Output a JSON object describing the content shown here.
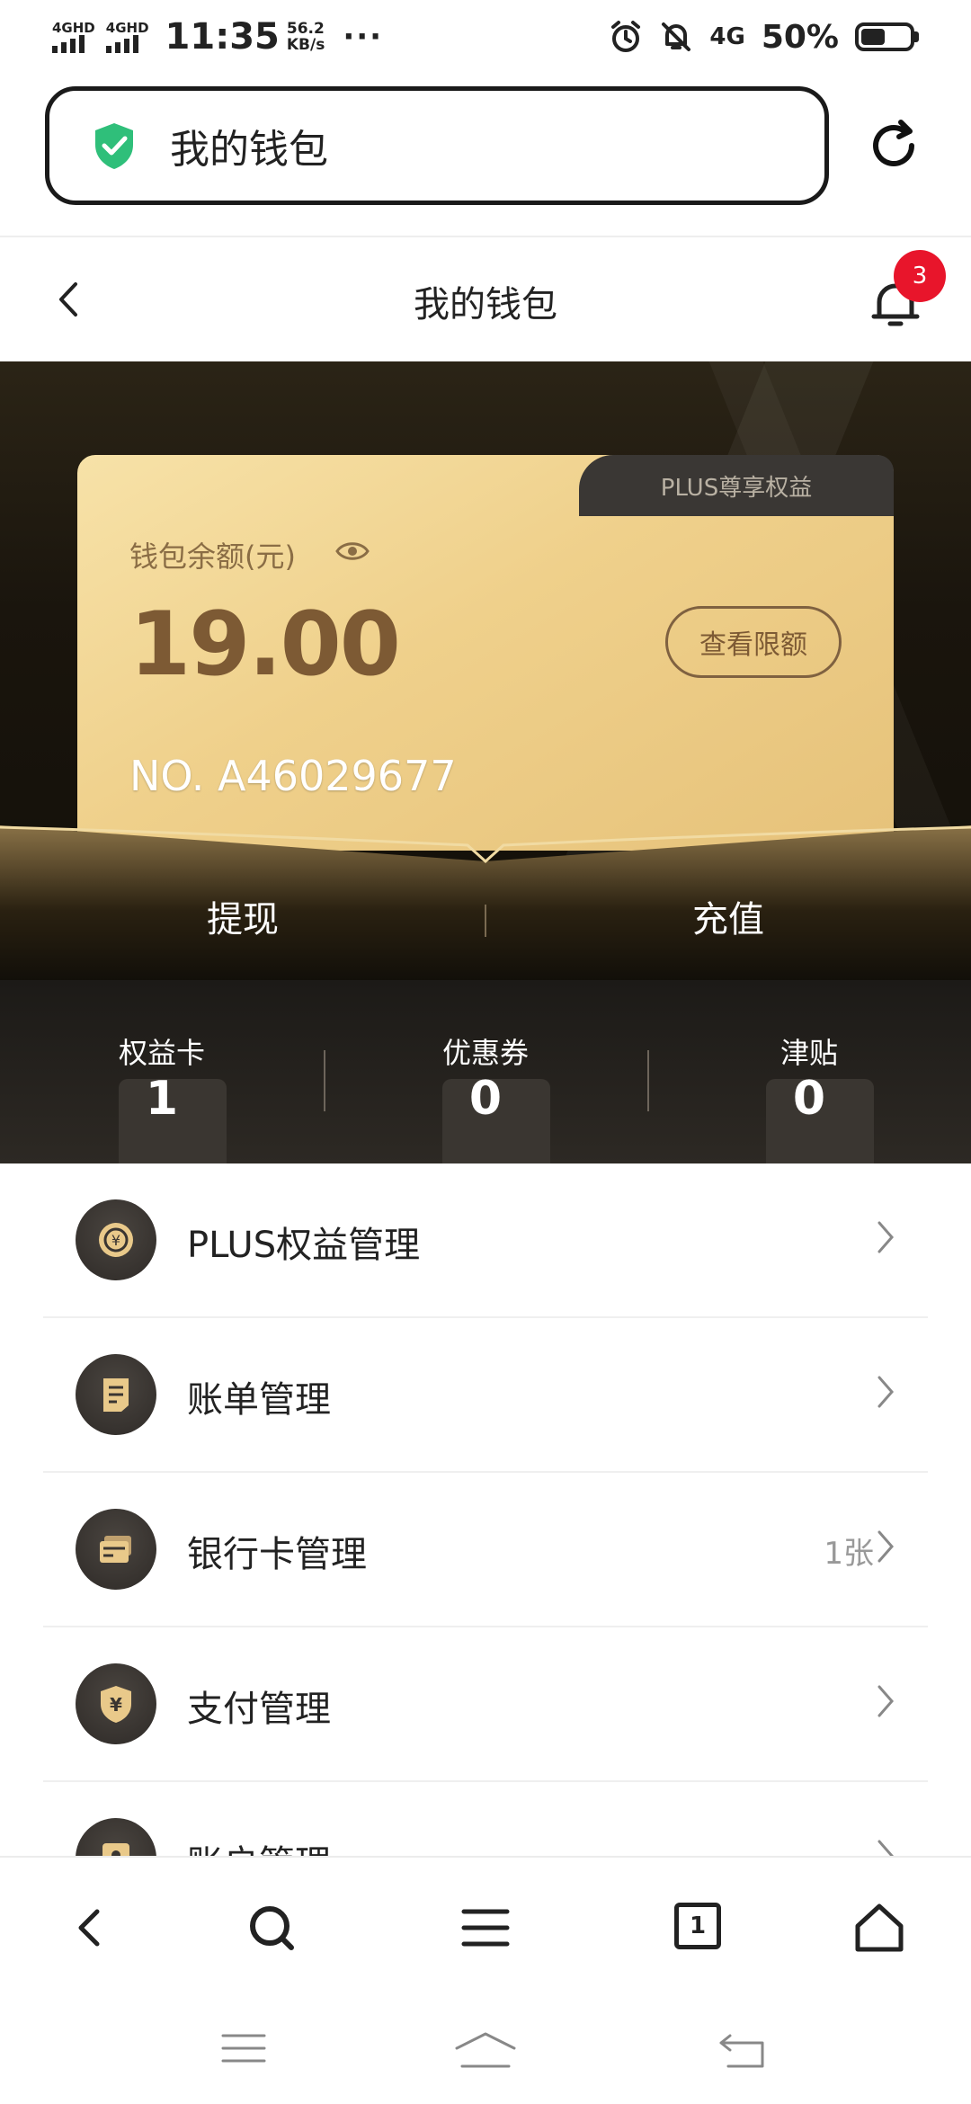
{
  "status_bar": {
    "sim1": "4GHD",
    "sim2": "4GHD",
    "time": "11:35",
    "speed_value": "56.2",
    "speed_unit": "KB/s",
    "dots": "···",
    "network": "4G",
    "battery": "50%",
    "battery_level": 0.5
  },
  "browser": {
    "url_title": "我的钱包"
  },
  "header": {
    "title": "我的钱包",
    "notification_count": "3"
  },
  "wallet": {
    "plus_tab": "PLUS尊享权益",
    "balance_label": "钱包余额(元)",
    "balance": "19.00",
    "limit_button": "查看限额",
    "number": "NO. A46029677",
    "withdraw": "提现",
    "recharge": "充值"
  },
  "stats": [
    {
      "label": "权益卡",
      "value": "1"
    },
    {
      "label": "优惠券",
      "value": "0"
    },
    {
      "label": "津贴",
      "value": "0"
    }
  ],
  "menu": [
    {
      "label": "PLUS权益管理",
      "extra": "",
      "icon": "coin-icon"
    },
    {
      "label": "账单管理",
      "extra": "",
      "icon": "bill-icon"
    },
    {
      "label": "银行卡管理",
      "extra": "1张",
      "icon": "bank-card-icon"
    },
    {
      "label": "支付管理",
      "extra": "",
      "icon": "yuan-shield-icon"
    },
    {
      "label": "账户管理",
      "extra": "",
      "icon": "account-icon"
    }
  ],
  "toolbar": {
    "tab_count": "1"
  },
  "colors": {
    "gold_light": "#f7e2a8",
    "gold_dark": "#7d5a34",
    "badge_red": "#e8152b",
    "shield_green": "#2fbf7a"
  }
}
